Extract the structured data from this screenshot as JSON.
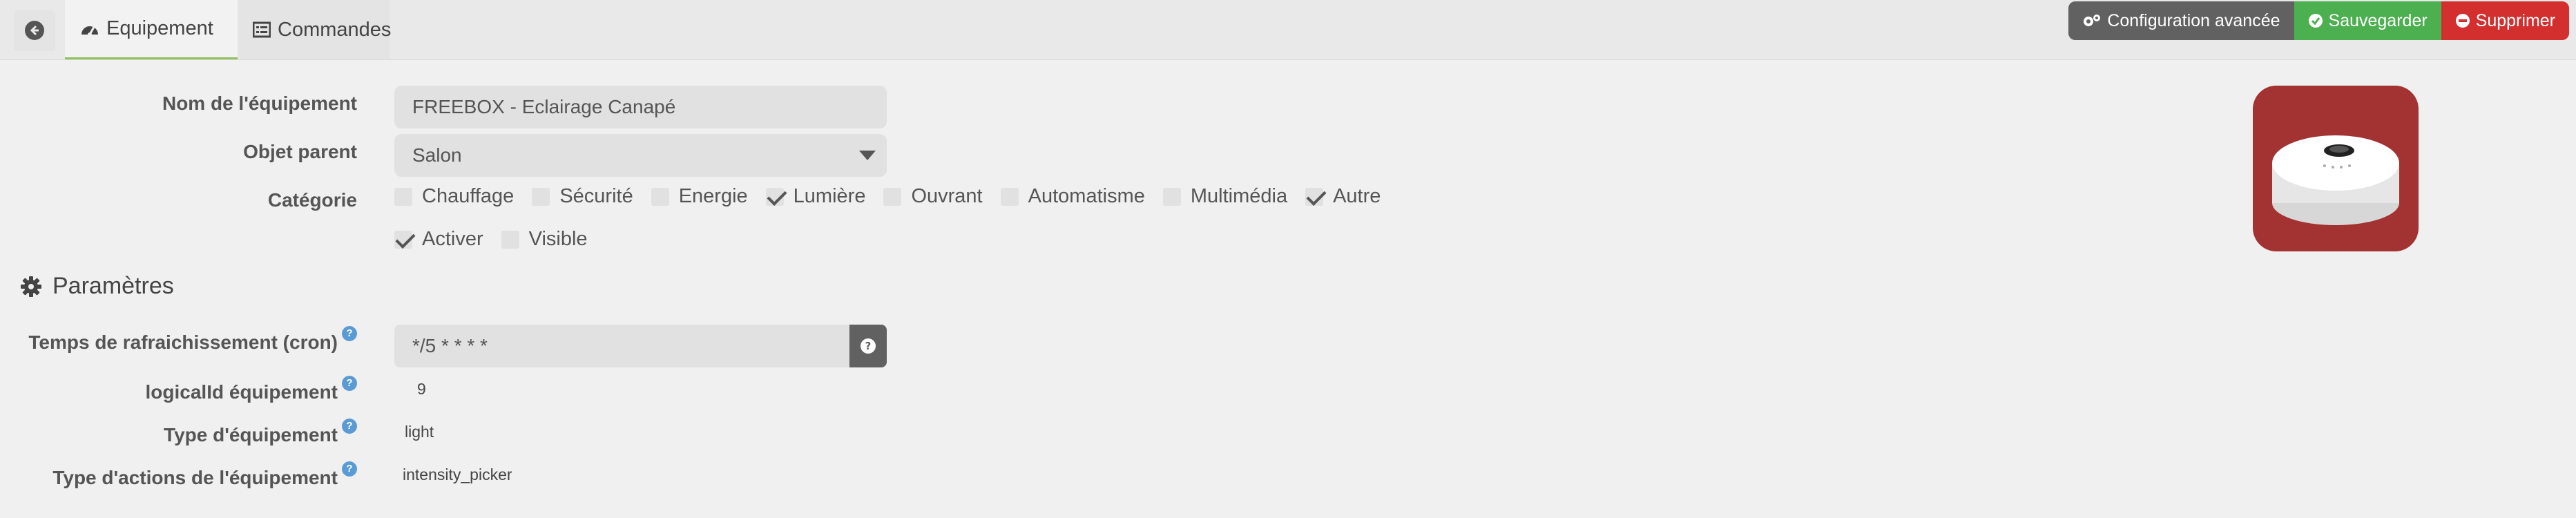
{
  "tabs": {
    "equipment": "Equipement",
    "commands": "Commandes"
  },
  "actions": {
    "config": "Configuration avancée",
    "save": "Sauvegarder",
    "delete": "Supprimer"
  },
  "form": {
    "name_label": "Nom de l'équipement",
    "name_value": "FREEBOX - Eclairage Canapé",
    "parent_label": "Objet parent",
    "parent_value": "Salon",
    "category_label": "Catégorie",
    "categories": [
      {
        "label": "Chauffage",
        "checked": false
      },
      {
        "label": "Sécurité",
        "checked": false
      },
      {
        "label": "Energie",
        "checked": false
      },
      {
        "label": "Lumière",
        "checked": true
      },
      {
        "label": "Ouvrant",
        "checked": false
      },
      {
        "label": "Automatisme",
        "checked": false
      },
      {
        "label": "Multimédia",
        "checked": false
      },
      {
        "label": "Autre",
        "checked": true
      }
    ],
    "enable_label": "Activer",
    "enable_checked": true,
    "visible_label": "Visible",
    "visible_checked": false
  },
  "params": {
    "title": "Paramètres",
    "cron_label": "Temps de rafraichissement (cron)",
    "cron_value": "*/5 * * * *",
    "logical_label": "logicalId équipement",
    "logical_value": "9",
    "type_label": "Type d'équipement",
    "type_value": "light",
    "action_label": "Type d'actions de l'équipement",
    "action_value": "intensity_picker"
  },
  "colors": {
    "save": "#4caf50",
    "delete": "#d32f2f",
    "config": "#616161",
    "active_tab_border": "#8fc25a",
    "help_icon": "#5b9bd5",
    "app_icon_bg": "#a33232"
  }
}
